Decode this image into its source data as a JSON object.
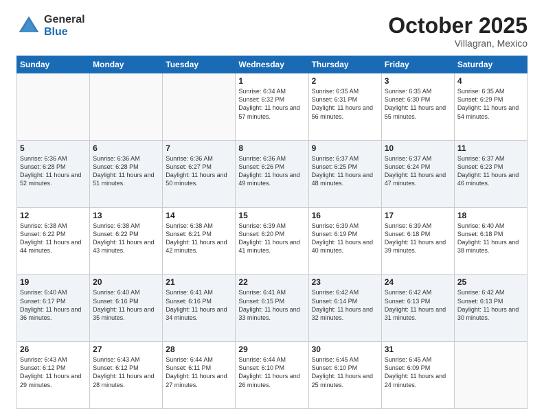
{
  "header": {
    "logo_general": "General",
    "logo_blue": "Blue",
    "title": "October 2025",
    "subtitle": "Villagran, Mexico"
  },
  "days_of_week": [
    "Sunday",
    "Monday",
    "Tuesday",
    "Wednesday",
    "Thursday",
    "Friday",
    "Saturday"
  ],
  "weeks": [
    [
      {
        "day": "",
        "info": ""
      },
      {
        "day": "",
        "info": ""
      },
      {
        "day": "",
        "info": ""
      },
      {
        "day": "1",
        "info": "Sunrise: 6:34 AM\nSunset: 6:32 PM\nDaylight: 11 hours\nand 57 minutes."
      },
      {
        "day": "2",
        "info": "Sunrise: 6:35 AM\nSunset: 6:31 PM\nDaylight: 11 hours\nand 56 minutes."
      },
      {
        "day": "3",
        "info": "Sunrise: 6:35 AM\nSunset: 6:30 PM\nDaylight: 11 hours\nand 55 minutes."
      },
      {
        "day": "4",
        "info": "Sunrise: 6:35 AM\nSunset: 6:29 PM\nDaylight: 11 hours\nand 54 minutes."
      }
    ],
    [
      {
        "day": "5",
        "info": "Sunrise: 6:36 AM\nSunset: 6:28 PM\nDaylight: 11 hours\nand 52 minutes."
      },
      {
        "day": "6",
        "info": "Sunrise: 6:36 AM\nSunset: 6:28 PM\nDaylight: 11 hours\nand 51 minutes."
      },
      {
        "day": "7",
        "info": "Sunrise: 6:36 AM\nSunset: 6:27 PM\nDaylight: 11 hours\nand 50 minutes."
      },
      {
        "day": "8",
        "info": "Sunrise: 6:36 AM\nSunset: 6:26 PM\nDaylight: 11 hours\nand 49 minutes."
      },
      {
        "day": "9",
        "info": "Sunrise: 6:37 AM\nSunset: 6:25 PM\nDaylight: 11 hours\nand 48 minutes."
      },
      {
        "day": "10",
        "info": "Sunrise: 6:37 AM\nSunset: 6:24 PM\nDaylight: 11 hours\nand 47 minutes."
      },
      {
        "day": "11",
        "info": "Sunrise: 6:37 AM\nSunset: 6:23 PM\nDaylight: 11 hours\nand 46 minutes."
      }
    ],
    [
      {
        "day": "12",
        "info": "Sunrise: 6:38 AM\nSunset: 6:22 PM\nDaylight: 11 hours\nand 44 minutes."
      },
      {
        "day": "13",
        "info": "Sunrise: 6:38 AM\nSunset: 6:22 PM\nDaylight: 11 hours\nand 43 minutes."
      },
      {
        "day": "14",
        "info": "Sunrise: 6:38 AM\nSunset: 6:21 PM\nDaylight: 11 hours\nand 42 minutes."
      },
      {
        "day": "15",
        "info": "Sunrise: 6:39 AM\nSunset: 6:20 PM\nDaylight: 11 hours\nand 41 minutes."
      },
      {
        "day": "16",
        "info": "Sunrise: 6:39 AM\nSunset: 6:19 PM\nDaylight: 11 hours\nand 40 minutes."
      },
      {
        "day": "17",
        "info": "Sunrise: 6:39 AM\nSunset: 6:18 PM\nDaylight: 11 hours\nand 39 minutes."
      },
      {
        "day": "18",
        "info": "Sunrise: 6:40 AM\nSunset: 6:18 PM\nDaylight: 11 hours\nand 38 minutes."
      }
    ],
    [
      {
        "day": "19",
        "info": "Sunrise: 6:40 AM\nSunset: 6:17 PM\nDaylight: 11 hours\nand 36 minutes."
      },
      {
        "day": "20",
        "info": "Sunrise: 6:40 AM\nSunset: 6:16 PM\nDaylight: 11 hours\nand 35 minutes."
      },
      {
        "day": "21",
        "info": "Sunrise: 6:41 AM\nSunset: 6:16 PM\nDaylight: 11 hours\nand 34 minutes."
      },
      {
        "day": "22",
        "info": "Sunrise: 6:41 AM\nSunset: 6:15 PM\nDaylight: 11 hours\nand 33 minutes."
      },
      {
        "day": "23",
        "info": "Sunrise: 6:42 AM\nSunset: 6:14 PM\nDaylight: 11 hours\nand 32 minutes."
      },
      {
        "day": "24",
        "info": "Sunrise: 6:42 AM\nSunset: 6:13 PM\nDaylight: 11 hours\nand 31 minutes."
      },
      {
        "day": "25",
        "info": "Sunrise: 6:42 AM\nSunset: 6:13 PM\nDaylight: 11 hours\nand 30 minutes."
      }
    ],
    [
      {
        "day": "26",
        "info": "Sunrise: 6:43 AM\nSunset: 6:12 PM\nDaylight: 11 hours\nand 29 minutes."
      },
      {
        "day": "27",
        "info": "Sunrise: 6:43 AM\nSunset: 6:12 PM\nDaylight: 11 hours\nand 28 minutes."
      },
      {
        "day": "28",
        "info": "Sunrise: 6:44 AM\nSunset: 6:11 PM\nDaylight: 11 hours\nand 27 minutes."
      },
      {
        "day": "29",
        "info": "Sunrise: 6:44 AM\nSunset: 6:10 PM\nDaylight: 11 hours\nand 26 minutes."
      },
      {
        "day": "30",
        "info": "Sunrise: 6:45 AM\nSunset: 6:10 PM\nDaylight: 11 hours\nand 25 minutes."
      },
      {
        "day": "31",
        "info": "Sunrise: 6:45 AM\nSunset: 6:09 PM\nDaylight: 11 hours\nand 24 minutes."
      },
      {
        "day": "",
        "info": ""
      }
    ]
  ]
}
